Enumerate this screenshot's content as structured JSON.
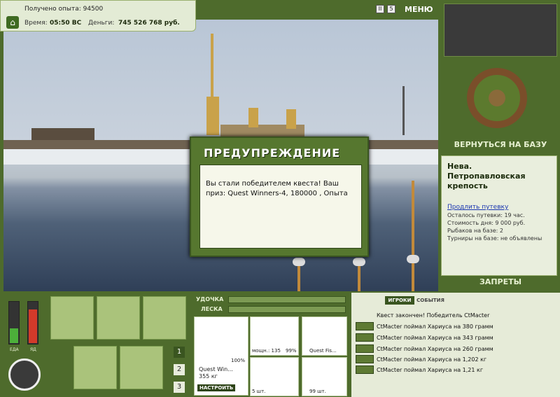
{
  "topbar": {
    "experience_label": "Получено опыта: 94500",
    "time_label": "Время:",
    "time_value": "05:50 ВС",
    "money_label": "Деньги:",
    "money_value": "745 526 768 руб."
  },
  "controls": {
    "pause": "II",
    "speed": "5",
    "menu": "МЕНЮ"
  },
  "right": {
    "back_button": "ВЕРНУТЬСЯ НА БАЗУ",
    "location": "Нева. Петропавловская крепость",
    "extend_link": "Продлить путевку",
    "lines": [
      "Осталось путевки: 19 час.",
      "Стоимость дня: 9 000 руб.",
      "Рыбаков на базе: 2",
      "Турниры на базе: не объявлены"
    ],
    "bans_button": "ЗАПРЕТЫ"
  },
  "dialog": {
    "title": "ПРЕДУПРЕЖДЕНИЕ",
    "message": "Вы стали победителем квеста! Ваш приз: Quest Winners-4, 180000 , Опыта"
  },
  "status": {
    "food_label": "ЕДА",
    "poison_label": "ЯД",
    "food_level": 0.35,
    "poison_level": 0.8,
    "pages": [
      "1",
      "2",
      "3"
    ]
  },
  "tackle": {
    "rod_label": "УДОЧКА",
    "line_label": "ЛЕСКА",
    "rod_name": "Quest Win...",
    "rod_weight": "355 кг",
    "rod_percent": "100%",
    "setup_button": "НАСТРОИТЬ",
    "reel_name": "мощн.: 135",
    "reel_percent": "99%",
    "line_name": "Quest Fis...",
    "hook_count": "5 шт.",
    "bait_count": "99 шт."
  },
  "events": {
    "tab_players": "ИГРОКИ",
    "tab_events": "СОБЫТИЯ",
    "items": [
      "Квест закончен! Победитель CtMacter",
      "CtMacter поймал Хариуса на 380 грамм",
      "CtMacter поймал Хариуса на 343 грамм",
      "CtMacter поймал Хариуса на 260 грамм",
      "CtMacter поймал Хариуса на 1,202 кг",
      "CtMacter поймал Хариуса на 1,21 кг"
    ]
  }
}
